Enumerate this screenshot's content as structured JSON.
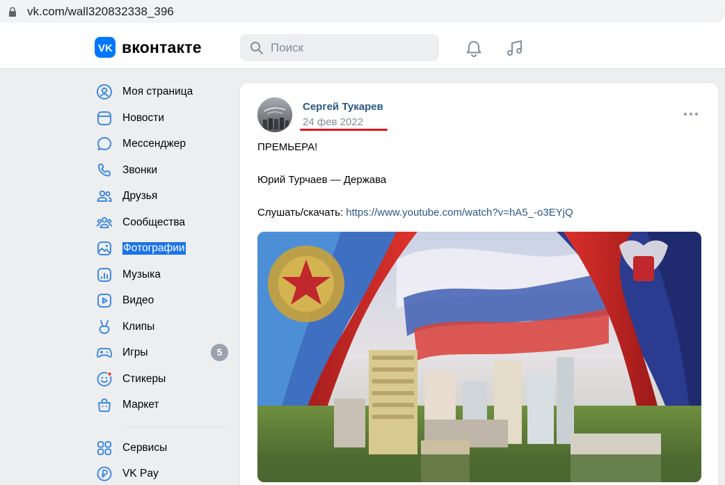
{
  "browser": {
    "url": "vk.com/wall320832338_396"
  },
  "header": {
    "logo_text": "вконтакте",
    "search_placeholder": "Поиск"
  },
  "sidebar": {
    "items": [
      {
        "label": "Моя страница",
        "icon": "user-circle-icon"
      },
      {
        "label": "Новости",
        "icon": "newsfeed-icon"
      },
      {
        "label": "Мессенджер",
        "icon": "message-icon"
      },
      {
        "label": "Звонки",
        "icon": "phone-icon"
      },
      {
        "label": "Друзья",
        "icon": "friends-icon"
      },
      {
        "label": "Сообщества",
        "icon": "groups-icon"
      },
      {
        "label": "Фотографии",
        "icon": "photo-icon",
        "selected": true
      },
      {
        "label": "Музыка",
        "icon": "music-icon"
      },
      {
        "label": "Видео",
        "icon": "video-icon"
      },
      {
        "label": "Клипы",
        "icon": "clips-icon"
      },
      {
        "label": "Игры",
        "icon": "games-icon",
        "badge": "5"
      },
      {
        "label": "Стикеры",
        "icon": "stickers-icon"
      },
      {
        "label": "Маркет",
        "icon": "market-icon"
      },
      {
        "label": "Сервисы",
        "icon": "services-icon"
      },
      {
        "label": "VK Pay",
        "icon": "vkpay-icon"
      }
    ]
  },
  "post": {
    "author": "Сергей Тукарев",
    "date": "24 фев 2022",
    "line1": "ПРЕМЬЕРА!",
    "line2": "Юрий Турчаев — Держава",
    "line3_prefix": "Слушать/скачать: ",
    "line3_link": "https://www.youtube.com/watch?v=hA5_-o3EYjQ"
  },
  "colors": {
    "accent": "#0077ff",
    "link": "#2a5885",
    "date_underline": "#e8141e"
  }
}
